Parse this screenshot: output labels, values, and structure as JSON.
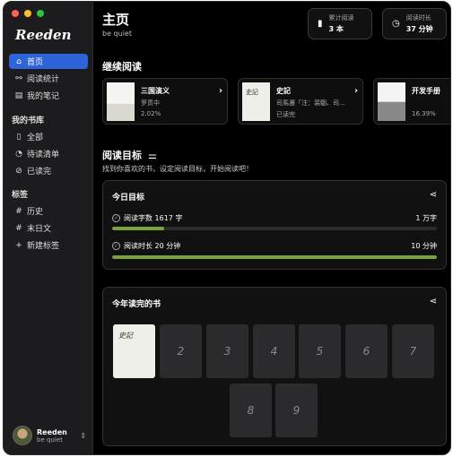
{
  "app": {
    "logo": "Reeden"
  },
  "sidebar": {
    "nav": [
      {
        "label": "首页",
        "icon": "home-icon",
        "glyph": "⌂",
        "active": true
      },
      {
        "label": "阅读统计",
        "icon": "stats-icon",
        "glyph": "⚯"
      },
      {
        "label": "我的笔记",
        "icon": "notes-icon",
        "glyph": "▤"
      }
    ],
    "library_title": "我的书库",
    "library": [
      {
        "label": "全部",
        "icon": "book-open-icon",
        "glyph": "▯"
      },
      {
        "label": "待读清单",
        "icon": "clock-icon",
        "glyph": "◔"
      },
      {
        "label": "已读完",
        "icon": "check-circle-icon",
        "glyph": "⊘"
      }
    ],
    "tags_title": "标签",
    "tags": [
      {
        "label": "历史",
        "icon": "hash-icon",
        "glyph": "#"
      },
      {
        "label": "末日文",
        "icon": "hash-icon",
        "glyph": "#"
      },
      {
        "label": "新建标签",
        "icon": "plus-icon",
        "glyph": "+"
      }
    ],
    "user": {
      "name": "Reeden",
      "subtitle": "be quiet"
    }
  },
  "header": {
    "title": "主页",
    "subtitle": "be quiet",
    "stats": [
      {
        "label": "累计阅读",
        "value": "3 本",
        "icon": "book-icon"
      },
      {
        "label": "阅读时长",
        "value": "37 分钟",
        "icon": "clock-icon"
      }
    ]
  },
  "continue": {
    "title": "继续阅读",
    "books": [
      {
        "title": "三国演义",
        "author": "罗贯中",
        "progress": "2.02%"
      },
      {
        "title": "史記",
        "author": "司馬遷「注：裴駰、司...",
        "progress": "已读完"
      },
      {
        "title": "开发手册",
        "author": "",
        "progress": "16.39%"
      }
    ]
  },
  "goals": {
    "title": "阅读目标",
    "description": "找到你喜欢的书，设定阅读目标，开始阅读吧！",
    "today": {
      "title": "今日目标",
      "rows": [
        {
          "label": "阅读字数 1617 字",
          "target": "1 万字",
          "fraction": 0.16
        },
        {
          "label": "阅读时长 20 分钟",
          "target": "10 分钟",
          "fraction": 1.0
        }
      ]
    }
  },
  "finished": {
    "title": "今年读完的书",
    "slots": [
      "",
      "2",
      "3",
      "4",
      "5",
      "6",
      "7",
      "8",
      "9"
    ]
  },
  "colors": {
    "accent": "#2f63d9",
    "progress": "#76a33a"
  }
}
